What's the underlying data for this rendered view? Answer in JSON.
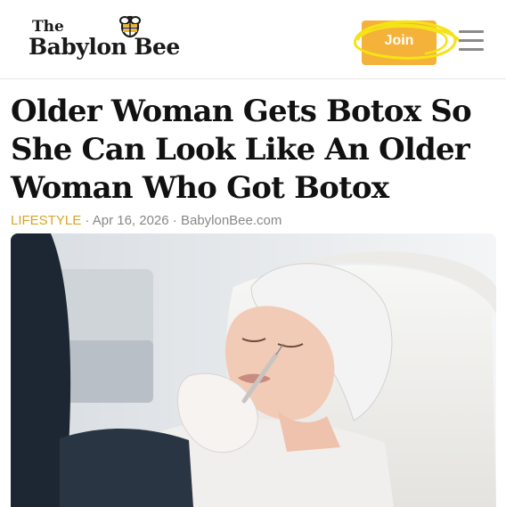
{
  "header": {
    "logo": {
      "line1": "The",
      "line2": "Babylon Bee"
    },
    "join_label": "Join",
    "colors": {
      "join_button": "#f5b23a",
      "scribble": "#f5e316"
    }
  },
  "article": {
    "headline": "Older Woman Gets Botox So She Can Look Like An Older Woman Who Got Botox",
    "category": "LIFESTYLE",
    "separator": "·",
    "date": "Apr 16, 2026",
    "source": "BabylonBee.com",
    "colors": {
      "category": "#d9a425",
      "meta": "#888888"
    }
  },
  "hero_image": {
    "subject": "woman in hair net receiving injection near lips"
  }
}
